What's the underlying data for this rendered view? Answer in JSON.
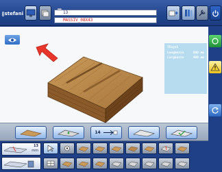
{
  "header": {
    "logo_text": "stefani",
    "program_number": "13",
    "file_name": "MASSIV_08X43"
  },
  "panel": {
    "title": "TExyz1",
    "rows": [
      {
        "label": "Lunghezza",
        "value": "600",
        "unit": "mm"
      },
      {
        "label": "Larghezza",
        "value": "400",
        "unit": "mm"
      }
    ]
  },
  "function_bar": {
    "counter_label": "14"
  },
  "bottom": {
    "big_label_top": "13",
    "big_label_unit": "mm"
  },
  "colors": {
    "warning": "#f0c419",
    "ok": "#2fb24b",
    "arrow": "#e8362b",
    "info_panel": "#b7dcef"
  }
}
